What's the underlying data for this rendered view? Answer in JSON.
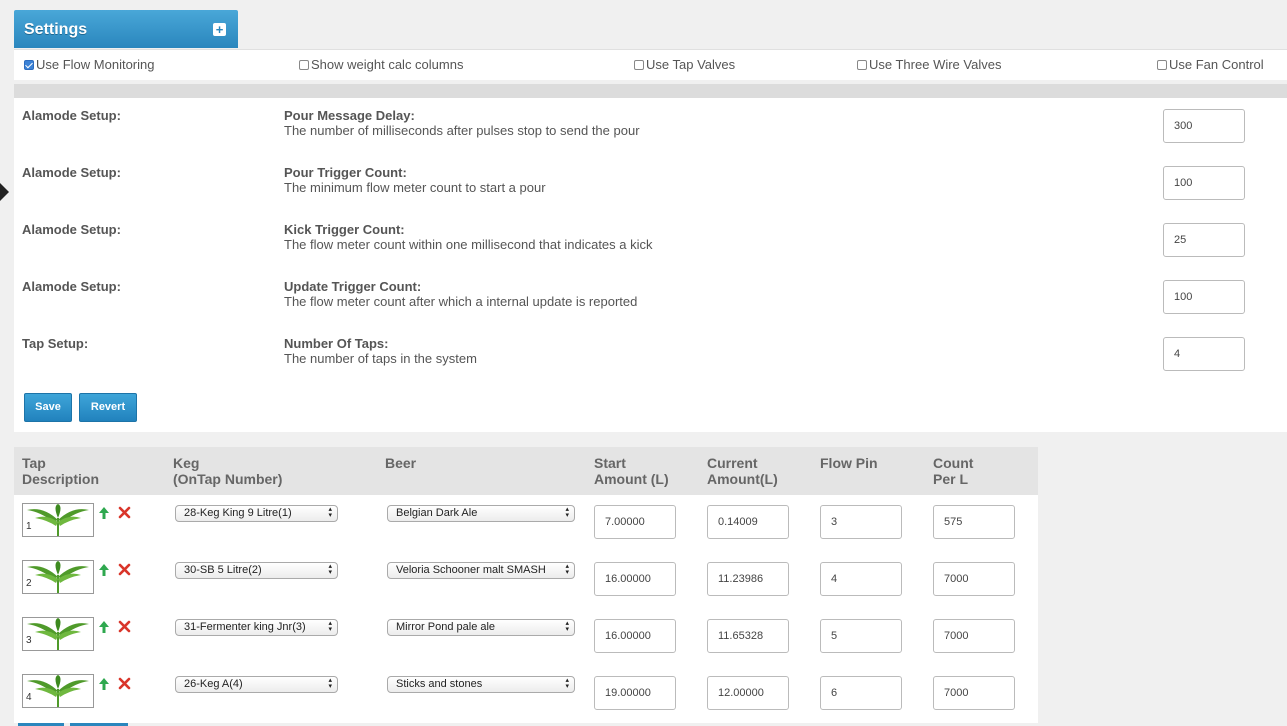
{
  "header": {
    "title": "Settings",
    "expand_symbol": "+"
  },
  "options": [
    {
      "label": "Use Flow Monitoring",
      "checked": true
    },
    {
      "label": "Show weight calc columns",
      "checked": false
    },
    {
      "label": "Use Tap Valves",
      "checked": false
    },
    {
      "label": "Use Three Wire Valves",
      "checked": false
    },
    {
      "label": "Use Fan Control",
      "checked": false
    }
  ],
  "settings": [
    {
      "category": "Alamode Setup:",
      "name": "Pour Message Delay:",
      "description": "The number of milliseconds after pulses stop to send the pour",
      "value": "300"
    },
    {
      "category": "Alamode Setup:",
      "name": "Pour Trigger Count:",
      "description": "The minimum flow meter count to start a pour",
      "value": "100"
    },
    {
      "category": "Alamode Setup:",
      "name": "Kick Trigger Count:",
      "description": "The flow meter count within one millisecond that indicates a kick",
      "value": "25"
    },
    {
      "category": "Alamode Setup:",
      "name": "Update Trigger Count:",
      "description": "The flow meter count after which a internal update is reported",
      "value": "100"
    },
    {
      "category": "Tap Setup:",
      "name": "Number Of Taps:",
      "description": "The number of taps in the system",
      "value": "4"
    }
  ],
  "buttons": {
    "save": "Save",
    "revert": "Revert"
  },
  "taps_table": {
    "headers": {
      "tap_line1": "Tap",
      "tap_line2": "Description",
      "keg_line1": "Keg",
      "keg_line2": "(OnTap Number)",
      "beer": "Beer",
      "start_line1": "Start",
      "start_line2": "Amount (L)",
      "current_line1": "Current",
      "current_line2": "Amount(L)",
      "pin": "Flow Pin",
      "count_line1": "Count",
      "count_line2": "Per L"
    },
    "rows": [
      {
        "tap_number": "1",
        "keg": "28-Keg King 9 Litre(1)",
        "beer": "Belgian Dark Ale",
        "start_amount": "7.00000",
        "current_amount": "0.14009",
        "flow_pin": "3",
        "count_per_l": "575"
      },
      {
        "tap_number": "2",
        "keg": "30-SB 5 Litre(2)",
        "beer": "Veloria Schooner malt SMASH",
        "start_amount": "16.00000",
        "current_amount": "11.23986",
        "flow_pin": "4",
        "count_per_l": "7000"
      },
      {
        "tap_number": "3",
        "keg": "31-Fermenter king Jnr(3)",
        "beer": "Mirror Pond pale ale",
        "start_amount": "16.00000",
        "current_amount": "11.65328",
        "flow_pin": "5",
        "count_per_l": "7000"
      },
      {
        "tap_number": "4",
        "keg": "26-Keg A(4)",
        "beer": "Sticks and stones",
        "start_amount": "19.00000",
        "current_amount": "12.00000",
        "flow_pin": "6",
        "count_per_l": "7000"
      }
    ]
  },
  "colors": {
    "accent": "#2a86bd",
    "up_arrow": "#2fa84f",
    "delete": "#d9352a",
    "tap_image": "#4f9a2a"
  },
  "icons": {
    "expand": "plus-icon",
    "move_up": "arrow-up-icon",
    "delete": "x-delete-icon",
    "tap_image": "tap-leaf-logo"
  }
}
